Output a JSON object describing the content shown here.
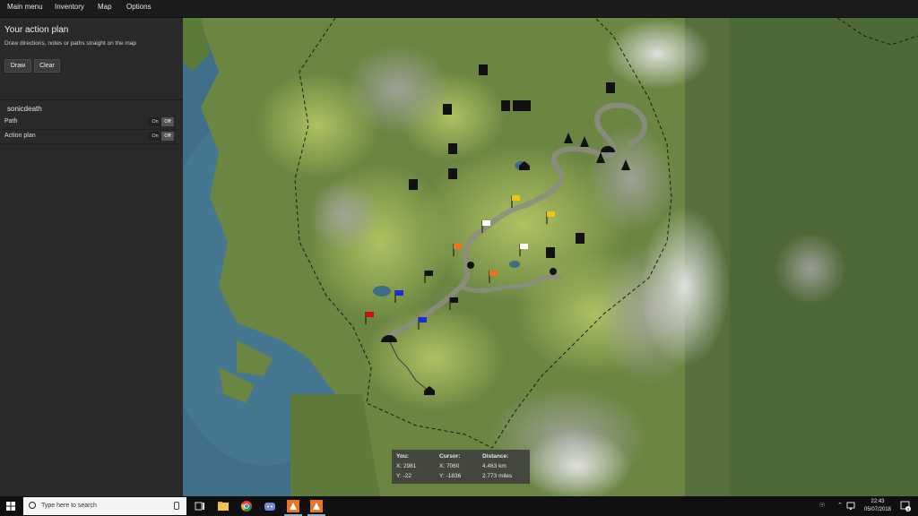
{
  "menu": {
    "items": [
      "Main menu",
      "Inventory",
      "Map",
      "Options"
    ]
  },
  "sidebar": {
    "title": "Your action plan",
    "description": "Draw directions, notes or paths straight on the map",
    "draw_label": "Draw",
    "clear_label": "Clear",
    "username": "sonicdeath",
    "toggles": [
      {
        "label": "Path",
        "on": "On",
        "off": "Off",
        "state": "off"
      },
      {
        "label": "Action plan",
        "on": "On",
        "off": "Off",
        "state": "off"
      }
    ]
  },
  "map": {
    "colors": {
      "sea": "#3f6f8a",
      "land": "#6f8a45",
      "light_land": "#a7be5a",
      "rock": "#7d7d7a",
      "snow": "#d9d9d9"
    },
    "markers": [
      {
        "type": "marker",
        "icon": "climber-icon"
      },
      {
        "type": "flag",
        "color": "#f1c40f"
      },
      {
        "type": "flag",
        "color": "#ffffff"
      },
      {
        "type": "flag",
        "color": "#f07020"
      },
      {
        "type": "flag",
        "color": "#1b2ed8"
      },
      {
        "type": "flag",
        "color": "#d01010"
      },
      {
        "type": "flag",
        "color": "#111111"
      }
    ]
  },
  "coords": {
    "you_label": "You:",
    "you_x": "X: 2981",
    "you_y": "Y: -22",
    "cursor_label": "Cursor:",
    "cursor_x": "X: 7060",
    "cursor_y": "Y: -1836",
    "distance_label": "Distance:",
    "distance_km": "4.463 km",
    "distance_miles": "2.773 miles"
  },
  "taskbar": {
    "search_placeholder": "Type here to search",
    "time": "22:43",
    "date": "05/07/2018",
    "notification_count": "3"
  }
}
